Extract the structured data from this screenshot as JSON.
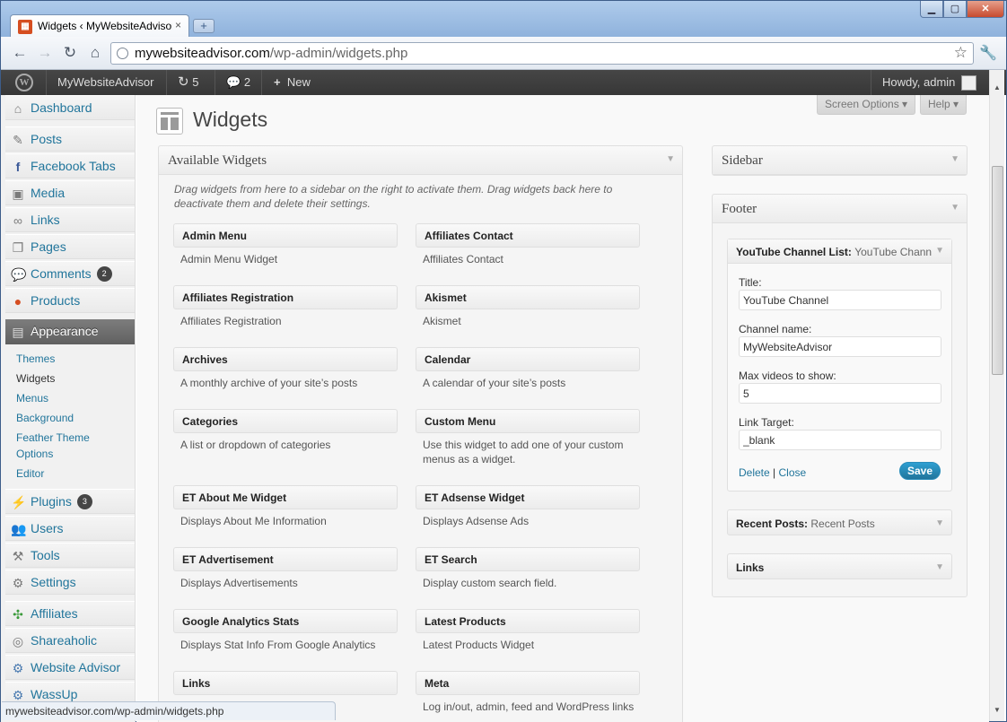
{
  "browser": {
    "tab_title": "Widgets ‹ MyWebsiteAdvisor",
    "tab_close": "×",
    "new_tab": "+",
    "url_host": "mywebsiteadvisor.com",
    "url_path": "/wp-admin/widgets.php",
    "status_url": "mywebsiteadvisor.com/wp-admin/widgets.php",
    "icons": [
      "back-icon",
      "forward-icon",
      "reload-icon",
      "home-icon",
      "star-icon",
      "wrench-icon"
    ]
  },
  "adminbar": {
    "site_name": "MyWebsiteAdvisor",
    "updates_count": "5",
    "comments_count": "2",
    "new_label": "New",
    "howdy": "Howdy, admin"
  },
  "menu": {
    "dashboard": "Dashboard",
    "posts": "Posts",
    "facebook_tabs": "Facebook Tabs",
    "media": "Media",
    "links": "Links",
    "pages": "Pages",
    "comments": "Comments",
    "comments_badge": "2",
    "products": "Products",
    "appearance": "Appearance",
    "sub": {
      "themes": "Themes",
      "widgets": "Widgets",
      "menus": "Menus",
      "background": "Background",
      "feather_theme_options_1": "Feather Theme",
      "feather_theme_options_2": "Options",
      "editor": "Editor"
    },
    "plugins": "Plugins",
    "plugins_badge": "3",
    "users": "Users",
    "tools": "Tools",
    "settings": "Settings",
    "affiliates": "Affiliates",
    "shareaholic": "Shareaholic",
    "website_advisor": "Website Advisor",
    "wassup": "WassUp"
  },
  "screen_meta": {
    "screen_options": "Screen Options ▾",
    "help": "Help ▾"
  },
  "page_title": "Widgets",
  "available": {
    "title": "Available Widgets",
    "description": "Drag widgets from here to a sidebar on the right to activate them. Drag widgets back here to deactivate them and delete their settings.",
    "widgets": [
      {
        "name": "Admin Menu",
        "desc": "Admin Menu Widget"
      },
      {
        "name": "Affiliates Contact",
        "desc": "Affiliates Contact"
      },
      {
        "name": "Affiliates Registration",
        "desc": "Affiliates Registration"
      },
      {
        "name": "Akismet",
        "desc": "Akismet"
      },
      {
        "name": "Archives",
        "desc": "A monthly archive of your site’s posts"
      },
      {
        "name": "Calendar",
        "desc": "A calendar of your site’s posts"
      },
      {
        "name": "Categories",
        "desc": "A list or dropdown of categories"
      },
      {
        "name": "Custom Menu",
        "desc": "Use this widget to add one of your custom menus as a widget."
      },
      {
        "name": "ET About Me Widget",
        "desc": "Displays About Me Information"
      },
      {
        "name": "ET Adsense Widget",
        "desc": "Displays Adsense Ads"
      },
      {
        "name": "ET Advertisement",
        "desc": "Displays Advertisements"
      },
      {
        "name": "ET Search",
        "desc": "Display custom search field."
      },
      {
        "name": "Google Analytics Stats",
        "desc": "Displays Stat Info From Google Analytics"
      },
      {
        "name": "Latest Products",
        "desc": "Latest Products Widget"
      },
      {
        "name": "Links",
        "desc": ""
      },
      {
        "name": "Meta",
        "desc": "Log in/out, admin, feed and WordPress links"
      }
    ]
  },
  "sidebar_area": {
    "title": "Sidebar"
  },
  "footer_area": {
    "title": "Footer",
    "youtube_widget": {
      "title": "YouTube Channel List:",
      "title_sub": "YouTube Channel",
      "title_label": "Title:",
      "title_value": "YouTube Channel",
      "channel_label": "Channel name:",
      "channel_value": "MyWebsiteAdvisor",
      "max_label": "Max videos to show:",
      "max_value": "5",
      "target_label": "Link Target:",
      "target_value": "_blank",
      "delete": "Delete",
      "separator": "|",
      "close": "Close",
      "save": "Save"
    },
    "recent_posts": {
      "title": "Recent Posts:",
      "title_sub": "Recent Posts"
    },
    "links": {
      "title": "Links"
    }
  },
  "colors": {
    "link": "#21759b",
    "adminbar": "#464646",
    "save_button": "#21759b"
  }
}
